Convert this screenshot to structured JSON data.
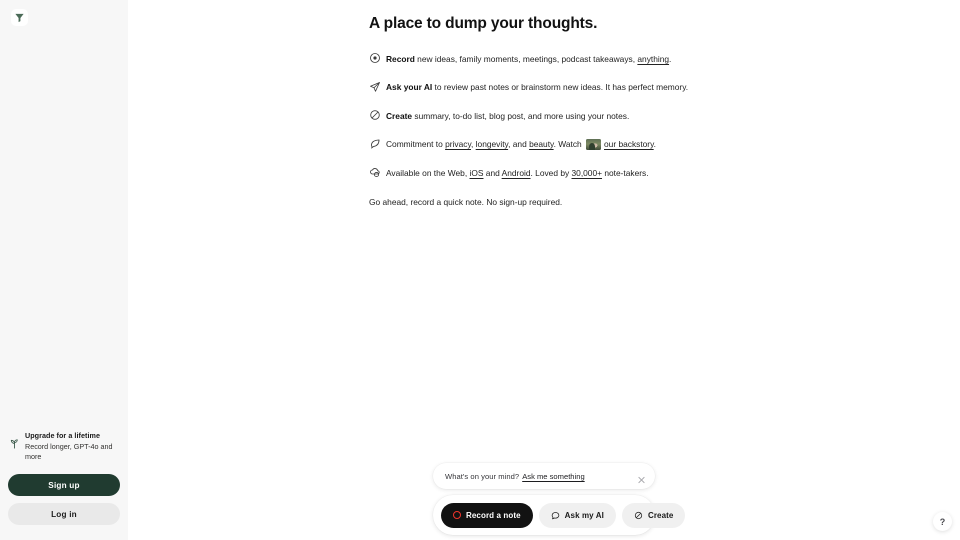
{
  "brand": {
    "logo_icon": "plant-leaf-logo",
    "accent_green": "#203b30",
    "accent_red": "#f0342b"
  },
  "main": {
    "title": "A place to dump your thoughts.",
    "features": [
      {
        "icon": "record-circle-icon",
        "lead": "Record",
        "text_before": " new ideas, family moments, meetings, podcast takeaways, ",
        "link1": "anything",
        "text_after": "."
      },
      {
        "icon": "paper-plane-icon",
        "lead": "Ask your AI",
        "text_before": " to review past notes or brainstorm new ideas. It has perfect memory.",
        "link1": "",
        "text_after": ""
      },
      {
        "icon": "sparkle-slash-icon",
        "lead": "Create",
        "text_before": " summary, to-do list, blog post, and more using your notes.",
        "link1": "",
        "text_after": ""
      }
    ],
    "commitment": {
      "icon": "shield-feather-icon",
      "prefix": "Commitment to ",
      "link_privacy": "privacy",
      "sep1": ", ",
      "link_longevity": "longevity",
      "sep2": ", and ",
      "link_beauty": "beauty",
      "middle": ". Watch ",
      "thumbnail": "backstory-video-thumbnail",
      "link_backstory": "our backstory",
      "suffix": "."
    },
    "availability": {
      "icon": "devices-cloud-icon",
      "prefix": "Available on the Web, ",
      "link_ios": "iOS",
      "sep": " and ",
      "link_android": "Android",
      "middle": ". Loved by ",
      "link_count": "30,000+",
      "suffix": " note-takers."
    },
    "closing": "Go ahead, record a quick note. No sign-up required."
  },
  "sidebar": {
    "upgrade": {
      "icon": "sprout-icon",
      "title": "Upgrade for a lifetime",
      "subtitle": "Record longer, GPT-4o and more"
    },
    "sign_up_label": "Sign up",
    "log_in_label": "Log in"
  },
  "dock": {
    "prompt": {
      "question": "What's on your mind?",
      "cta": "Ask me something",
      "close_icon": "close-icon"
    },
    "actions": [
      {
        "id": "record",
        "label": "Record a note",
        "icon": "record-dot-icon"
      },
      {
        "id": "ask",
        "label": "Ask my AI",
        "icon": "chat-bubble-icon"
      },
      {
        "id": "create",
        "label": "Create",
        "icon": "sparkle-slash-icon"
      }
    ]
  },
  "help": {
    "label": "?"
  }
}
